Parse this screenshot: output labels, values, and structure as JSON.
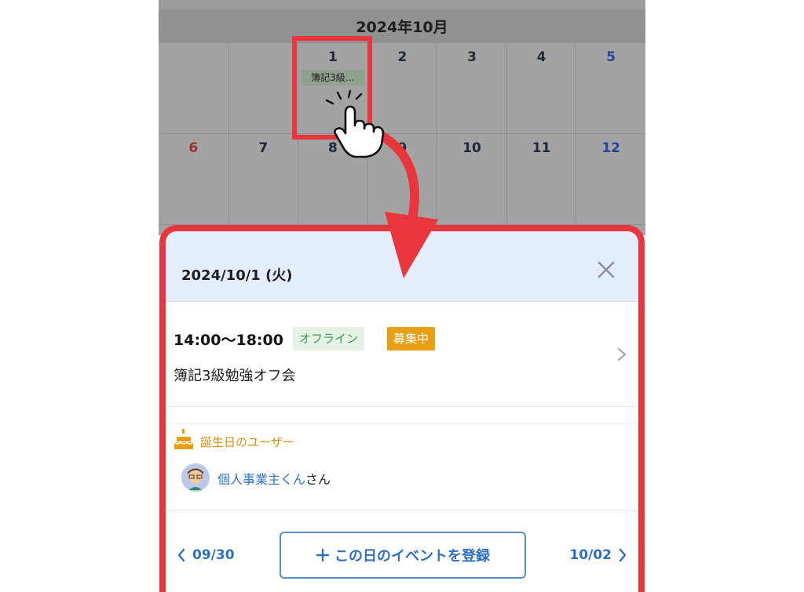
{
  "calendar": {
    "month_title": "2024年10月",
    "week1": [
      {
        "day": "",
        "type": "empty"
      },
      {
        "day": "",
        "type": "empty"
      },
      {
        "day": "1",
        "type": "weekday",
        "event": "簿記3級…"
      },
      {
        "day": "2",
        "type": "weekday"
      },
      {
        "day": "3",
        "type": "weekday"
      },
      {
        "day": "4",
        "type": "weekday"
      },
      {
        "day": "5",
        "type": "sat"
      }
    ],
    "week2": [
      {
        "day": "6",
        "type": "sun"
      },
      {
        "day": "7",
        "type": "weekday"
      },
      {
        "day": "8",
        "type": "weekday"
      },
      {
        "day": "9",
        "type": "weekday"
      },
      {
        "day": "10",
        "type": "weekday"
      },
      {
        "day": "11",
        "type": "weekday"
      },
      {
        "day": "12",
        "type": "sat"
      }
    ]
  },
  "panel": {
    "date": "2024/10/1 (火)",
    "event": {
      "time": "14:00〜18:00",
      "badge_offline": "オフライン",
      "badge_status": "募集中",
      "title": "簿記3級勉強オフ会"
    },
    "birthday": {
      "heading": "誕生日のユーザー",
      "user_name": "個人事業主くん",
      "suffix": "さん"
    },
    "nav": {
      "prev": "09/30",
      "next": "10/02",
      "add_event": "この日のイベントを登録"
    }
  },
  "colors": {
    "highlight": "#e8363c",
    "accent_blue": "#2f6fbf",
    "badge_offline_bg": "#e4f3e6",
    "badge_offline_text": "#3e9a55",
    "badge_recruit_bg": "#e8a012",
    "birthday_orange": "#d98d0c",
    "header_bg": "#e3edfb"
  },
  "icons": [
    "pointing-hand-icon",
    "curved-arrow-icon",
    "close-icon",
    "chevron-right-icon",
    "birthday-cake-icon",
    "avatar-icon",
    "chevron-left-icon",
    "plus-icon"
  ]
}
